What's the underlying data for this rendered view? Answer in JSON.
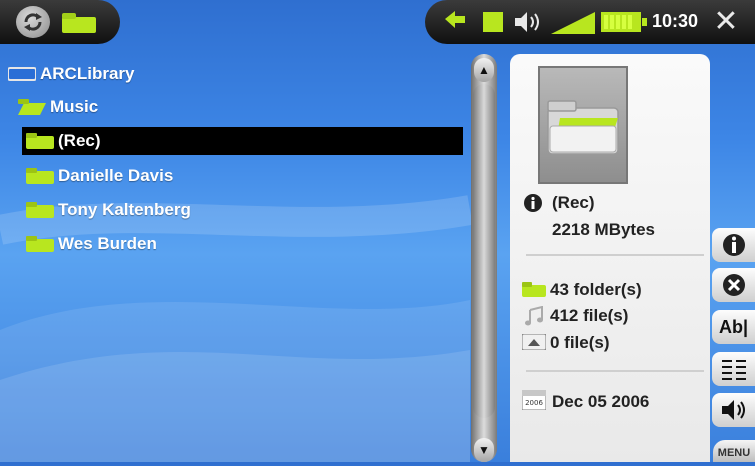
{
  "status_bar": {
    "time": "10:30",
    "close_label": "✕"
  },
  "tree": {
    "items": [
      {
        "label": "ARCLibrary",
        "level": 0,
        "type": "library"
      },
      {
        "label": "Music",
        "level": 1,
        "type": "folder-open"
      },
      {
        "label": "(Rec)",
        "level": 2,
        "type": "folder",
        "selected": true
      },
      {
        "label": "Danielle Davis",
        "level": 2,
        "type": "folder"
      },
      {
        "label": "Tony Kaltenberg",
        "level": 2,
        "type": "folder"
      },
      {
        "label": "Wes Burden",
        "level": 2,
        "type": "folder"
      }
    ]
  },
  "scrollbar": {
    "up_label": "▲",
    "down_label": "▼"
  },
  "info": {
    "name": "(Rec)",
    "size": "2218 MBytes",
    "folders": "43 folder(s)",
    "music_files": "412 file(s)",
    "video_files": "0 file(s)",
    "date": "Dec 05 2006",
    "calendar_year": "2006"
  },
  "side_buttons": {
    "text_label": "Ab|",
    "menu_label": "MENU"
  },
  "colors": {
    "accent_green": "#b8e61f",
    "selection": "#000000"
  }
}
